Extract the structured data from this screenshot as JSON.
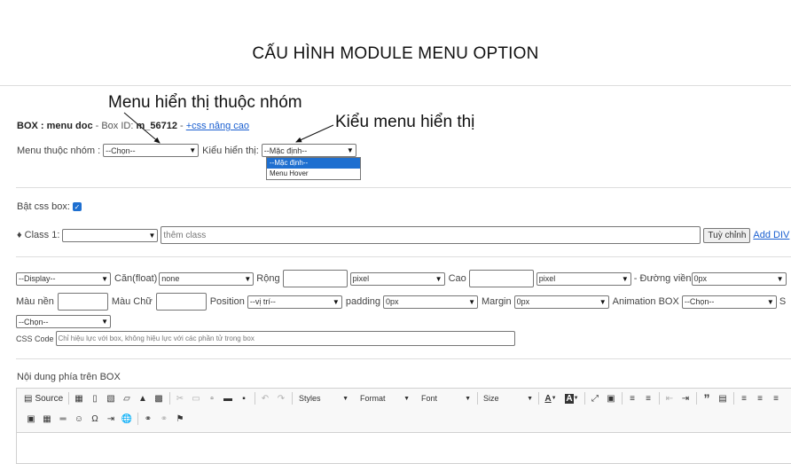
{
  "page": {
    "title": "CẤU HÌNH MODULE MENU OPTION"
  },
  "annotations": {
    "group_menu": "Menu hiển thị thuộc nhóm",
    "menu_type": "Kiểu menu hiển thị"
  },
  "box": {
    "label": "BOX : menu doc",
    "id_prefix": " - Box ID: ",
    "id": "m_56712",
    "sep": " - ",
    "css_link": "+css nâng cao"
  },
  "menu_row": {
    "group_label": "Menu thuộc nhóm :",
    "group_value": "--Chọn--",
    "type_label": "Kiểu hiển thị:",
    "type_value": "--Mặc định--",
    "type_options": [
      "--Mặc định--",
      "Menu Hover"
    ]
  },
  "css_box": {
    "label": "Bật css box:"
  },
  "class_row": {
    "label": "♦ Class 1:",
    "input_placeholder": "thêm class",
    "custom_button": "Tuỳ chỉnh",
    "add_link": "Add DIV"
  },
  "style_row1": {
    "display_value": "--Display--",
    "float_label": "Căn(float)",
    "float_value": "none",
    "width_label": "Rộng",
    "width_unit": "pixel",
    "height_label": "Cao",
    "height_unit": "pixel",
    "border_label": "- Đường viền",
    "border_value": "0px"
  },
  "style_row2": {
    "bg_label": "Màu nền",
    "color_label": "Màu Chữ",
    "position_label": "Position",
    "position_value": "--vị trí--",
    "padding_label": "padding",
    "padding_value": "0px",
    "margin_label": "Margin",
    "margin_value": "0px",
    "animation_label": "Animation BOX",
    "animation_value": "--Chọn--",
    "extra_label": "S"
  },
  "style_row3": {
    "select_value": "--Chọn--"
  },
  "css_code": {
    "label": "CSS Code",
    "placeholder": "Chỉ hiệu lực với box, không hiệu lực với các phần tử trong box"
  },
  "content": {
    "label": "Nội dung phía trên BOX"
  },
  "editor": {
    "source_label": "Source",
    "styles_label": "Styles",
    "format_label": "Format",
    "font_label": "Font",
    "size_label": "Size"
  }
}
